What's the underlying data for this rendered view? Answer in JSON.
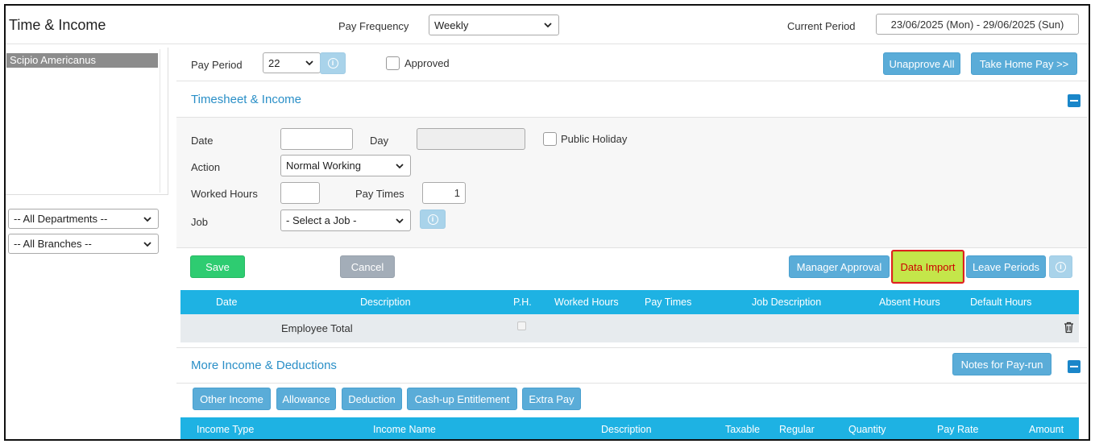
{
  "header": {
    "title": "Time & Income",
    "pay_frequency_label": "Pay Frequency",
    "pay_frequency_value": "Weekly",
    "current_period_label": "Current Period",
    "current_period_value": "23/06/2025 (Mon) - 29/06/2025 (Sun)"
  },
  "sidebar": {
    "employees": [
      "Scipio Americanus"
    ],
    "department_filter": "-- All Departments --",
    "branch_filter": "-- All Branches --"
  },
  "pay_period": {
    "label": "Pay Period",
    "value": "22",
    "approved_label": "Approved",
    "unapprove_all": "Unapprove All",
    "take_home_pay": "Take Home Pay >>"
  },
  "timesheet": {
    "title": "Timesheet & Income",
    "date_label": "Date",
    "date_value": "",
    "day_label": "Day",
    "day_value": "",
    "public_holiday_label": "Public Holiday",
    "action_label": "Action",
    "action_value": "Normal Working",
    "worked_hours_label": "Worked Hours",
    "worked_hours_value": "",
    "pay_times_label": "Pay Times",
    "pay_times_value": "1",
    "job_label": "Job",
    "job_value": "- Select a Job -"
  },
  "actions": {
    "save": "Save",
    "cancel": "Cancel",
    "manager_approval": "Manager Approval",
    "data_import": "Data Import",
    "leave_periods": "Leave Periods"
  },
  "timesheet_table": {
    "columns": [
      "Date",
      "Description",
      "P.H.",
      "Worked Hours",
      "Pay Times",
      "Job Description",
      "Absent Hours",
      "Default Hours"
    ],
    "total_row_label": "Employee Total"
  },
  "more_income": {
    "title": "More Income & Deductions",
    "notes_button": "Notes for Pay-run",
    "tabs": [
      "Other Income",
      "Allowance",
      "Deduction",
      "Cash-up Entitlement",
      "Extra Pay"
    ],
    "columns": [
      "Income Type",
      "Income Name",
      "Description",
      "Taxable",
      "Regular",
      "Quantity",
      "Pay Rate",
      "Amount"
    ]
  },
  "colors": {
    "accent": "#1eb2e3",
    "button": "#5aacd8",
    "save": "#2ecc71",
    "highlight": "#c4e64a",
    "section_title": "#2a8fc7"
  }
}
